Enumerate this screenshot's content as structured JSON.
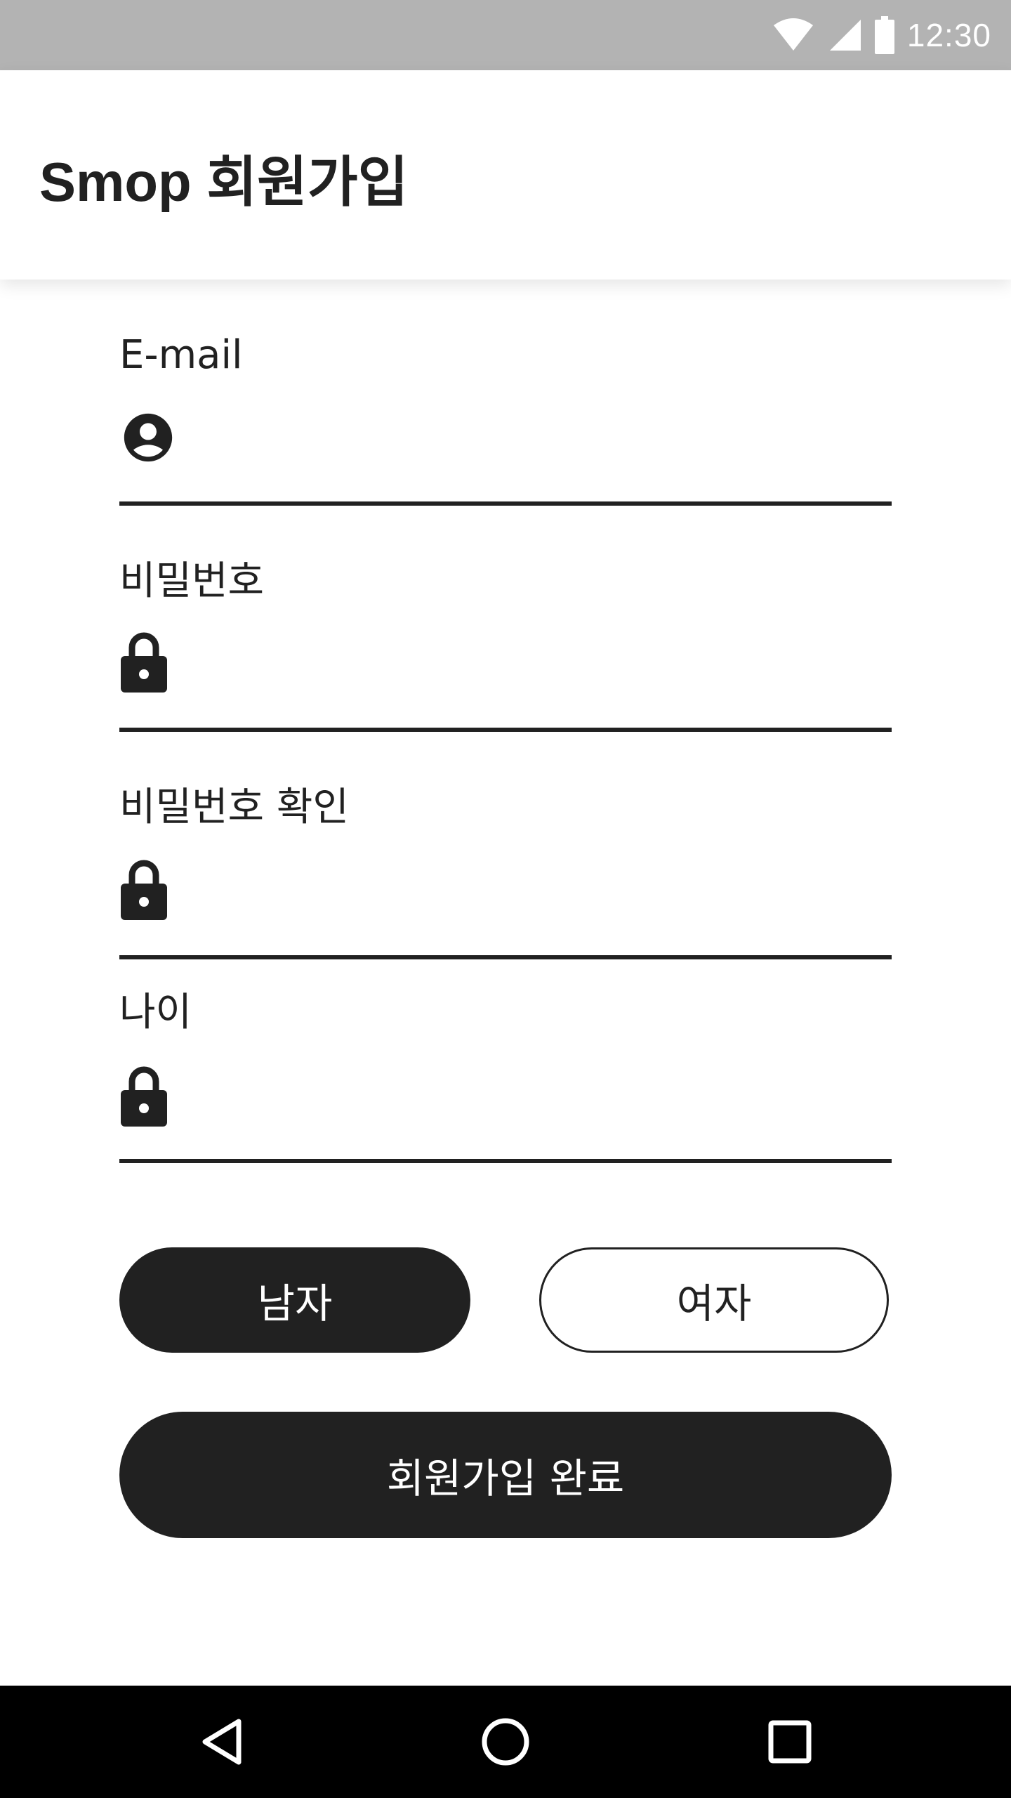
{
  "status_bar": {
    "time": "12:30",
    "icons": [
      "wifi-icon",
      "cell-signal-icon",
      "battery-icon"
    ]
  },
  "app_bar": {
    "title": "Smop 회원가입"
  },
  "form": {
    "email": {
      "label": "E-mail",
      "icon": "account-circle-icon",
      "value": ""
    },
    "password": {
      "label": "비밀번호",
      "icon": "lock-icon",
      "value": ""
    },
    "password_confirm": {
      "label": "비밀번호 확인",
      "icon": "lock-icon",
      "value": ""
    },
    "age": {
      "label": "나이",
      "icon": "lock-icon",
      "value": ""
    }
  },
  "gender": {
    "male_label": "남자",
    "female_label": "여자",
    "selected": "male"
  },
  "submit_label": "회원가입 완료",
  "nav_bar": {
    "buttons": [
      "back-icon",
      "home-icon",
      "recents-icon"
    ]
  },
  "colors": {
    "status_bar": "#b3b3b3",
    "primary_dark": "#212121",
    "background": "#ffffff",
    "nav_bar": "#000000"
  }
}
